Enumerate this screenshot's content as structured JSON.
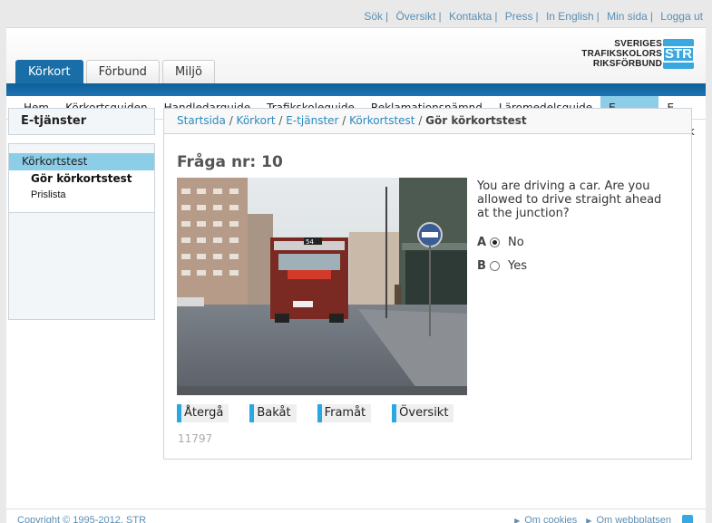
{
  "top_links": [
    "Sök",
    "Översikt",
    "Kontakta",
    "Press",
    "In English",
    "Min sida",
    "Logga ut"
  ],
  "logo": {
    "line1": "SVERIGES",
    "line2": "TRAFIKSKOLORS",
    "line3": "RIKSFÖRBUND",
    "mark": "STR"
  },
  "tabs": [
    {
      "label": "Körkort",
      "active": true
    },
    {
      "label": "Förbund",
      "active": false
    },
    {
      "label": "Miljö",
      "active": false
    }
  ],
  "nav": [
    {
      "label": "Hem",
      "active": false
    },
    {
      "label": "Körkortsguiden",
      "active": false
    },
    {
      "label": "Handledarguide",
      "active": false
    },
    {
      "label": "Trafikskoleguide",
      "active": false
    },
    {
      "label": "Reklamationsnämnd",
      "active": false
    },
    {
      "label": "Läromedelsguide",
      "active": false
    },
    {
      "label": "E-tjänster",
      "active": true
    },
    {
      "label": "E-butik",
      "active": false
    }
  ],
  "sidebar": {
    "title": "E-tjänster",
    "section": "Körkortstest",
    "sub1": "Gör körkortstest",
    "sub2": "Prislista"
  },
  "breadcrumb": {
    "items": [
      "Startsida",
      "Körkort",
      "E-tjänster",
      "Körkortstest"
    ],
    "current": "Gör körkortstest"
  },
  "question": {
    "title": "Fråga nr: 10",
    "text": "You are driving a car. Are you allowed to drive straight ahead at the junction?",
    "answers": [
      {
        "letter": "A",
        "label": "No",
        "checked": true
      },
      {
        "letter": "B",
        "label": "Yes",
        "checked": false
      }
    ],
    "bus_sign": "54",
    "id": "11797"
  },
  "buttons": [
    "Återgå",
    "Bakåt",
    "Framåt",
    "Översikt"
  ],
  "footer": {
    "copyright": "Copyright © 1995-2012, STR",
    "links": [
      "Om cookies",
      "Om webbplatsen"
    ]
  },
  "colors": {
    "brand_blue": "#1a6ea8",
    "accent": "#29a7e0",
    "nav_active": "#8ccde8"
  }
}
